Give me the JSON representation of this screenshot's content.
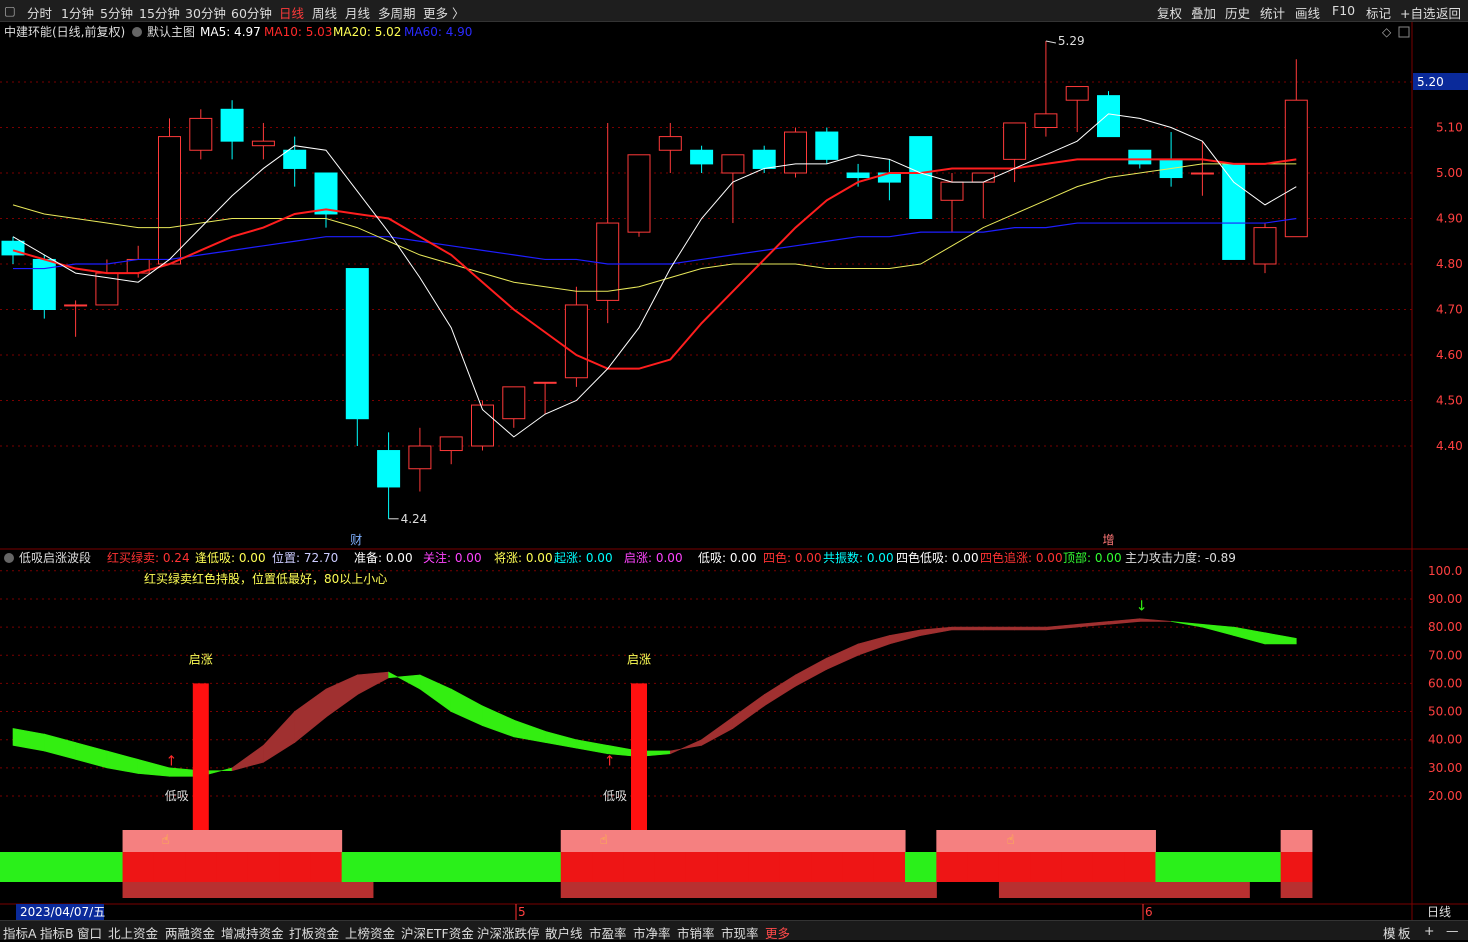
{
  "toolbar": {
    "periods": [
      "分时",
      "1分钟",
      "5分钟",
      "15分钟",
      "30分钟",
      "60分钟",
      "日线",
      "周线",
      "月线",
      "多周期",
      "更多 〉"
    ],
    "active_period": "日线",
    "right_items": [
      "复权",
      "叠加",
      "历史",
      "统计",
      "画线",
      "F10",
      "标记",
      "+自选",
      "返回"
    ]
  },
  "main_header": {
    "stock": "中建环能(日线,前复权)",
    "template": "默认主图",
    "ma": [
      {
        "label": "MA5: 4.97",
        "color": "#ffffff"
      },
      {
        "label": "MA10: 5.03",
        "color": "#ff2a2a"
      },
      {
        "label": "MA20: 5.02",
        "color": "#ffff55"
      },
      {
        "label": "MA60: 4.90",
        "color": "#2a2aff"
      }
    ]
  },
  "price_axis": {
    "ticks": [
      "5.20",
      "5.10",
      "5.00",
      "4.90",
      "4.80",
      "4.70",
      "4.60",
      "4.50",
      "4.40"
    ],
    "current_price": "5.20"
  },
  "annotations": {
    "high": "5.29",
    "low": "4.24",
    "marker1": "财",
    "marker2": "增"
  },
  "colors": {
    "up": "#ff3a3a",
    "down": "#00ffff",
    "ma5": "#ffffff",
    "ma10": "#ff1e1e",
    "ma20": "#e8e85a",
    "ma60": "#1e1eff",
    "grid": "#7a0000"
  },
  "chart_data": {
    "type": "candlestick",
    "candles": [
      {
        "o": 4.85,
        "h": 4.86,
        "l": 4.8,
        "c": 4.82
      },
      {
        "o": 4.81,
        "h": 4.82,
        "l": 4.68,
        "c": 4.7
      },
      {
        "o": 4.71,
        "h": 4.72,
        "l": 4.64,
        "c": 4.71
      },
      {
        "o": 4.71,
        "h": 4.81,
        "l": 4.71,
        "c": 4.78
      },
      {
        "o": 4.78,
        "h": 4.84,
        "l": 4.77,
        "c": 4.81
      },
      {
        "o": 4.8,
        "h": 5.12,
        "l": 4.8,
        "c": 5.08
      },
      {
        "o": 5.05,
        "h": 5.14,
        "l": 5.03,
        "c": 5.12
      },
      {
        "o": 5.14,
        "h": 5.16,
        "l": 5.03,
        "c": 5.07
      },
      {
        "o": 5.06,
        "h": 5.11,
        "l": 5.03,
        "c": 5.07
      },
      {
        "o": 5.05,
        "h": 5.08,
        "l": 4.97,
        "c": 5.01
      },
      {
        "o": 5.0,
        "h": 5.0,
        "l": 4.88,
        "c": 4.91
      },
      {
        "o": 4.79,
        "h": 4.79,
        "l": 4.4,
        "c": 4.46
      },
      {
        "o": 4.39,
        "h": 4.43,
        "l": 4.24,
        "c": 4.31
      },
      {
        "o": 4.35,
        "h": 4.44,
        "l": 4.3,
        "c": 4.4
      },
      {
        "o": 4.39,
        "h": 4.41,
        "l": 4.36,
        "c": 4.42
      },
      {
        "o": 4.4,
        "h": 4.5,
        "l": 4.39,
        "c": 4.49
      },
      {
        "o": 4.46,
        "h": 4.53,
        "l": 4.44,
        "c": 4.53
      },
      {
        "o": 4.54,
        "h": 4.54,
        "l": 4.47,
        "c": 4.54
      },
      {
        "o": 4.55,
        "h": 4.75,
        "l": 4.53,
        "c": 4.71
      },
      {
        "o": 4.72,
        "h": 5.11,
        "l": 4.67,
        "c": 4.89
      },
      {
        "o": 4.87,
        "h": 5.04,
        "l": 4.86,
        "c": 5.04
      },
      {
        "o": 5.05,
        "h": 5.11,
        "l": 5.0,
        "c": 5.08
      },
      {
        "o": 5.05,
        "h": 5.06,
        "l": 5.0,
        "c": 5.02
      },
      {
        "o": 5.0,
        "h": 5.04,
        "l": 4.89,
        "c": 5.04
      },
      {
        "o": 5.05,
        "h": 5.06,
        "l": 5.0,
        "c": 5.01
      },
      {
        "o": 5.0,
        "h": 5.1,
        "l": 4.99,
        "c": 5.09
      },
      {
        "o": 5.09,
        "h": 5.1,
        "l": 5.02,
        "c": 5.03
      },
      {
        "o": 5.0,
        "h": 5.02,
        "l": 4.97,
        "c": 4.99
      },
      {
        "o": 5.0,
        "h": 5.03,
        "l": 4.94,
        "c": 4.98
      },
      {
        "o": 5.08,
        "h": 5.08,
        "l": 4.9,
        "c": 4.9
      },
      {
        "o": 4.94,
        "h": 5.0,
        "l": 4.87,
        "c": 4.98
      },
      {
        "o": 4.98,
        "h": 5.0,
        "l": 4.9,
        "c": 5.0
      },
      {
        "o": 5.03,
        "h": 5.11,
        "l": 4.98,
        "c": 5.11
      },
      {
        "o": 5.1,
        "h": 5.29,
        "l": 5.08,
        "c": 5.13
      },
      {
        "o": 5.16,
        "h": 5.18,
        "l": 5.09,
        "c": 5.19
      },
      {
        "o": 5.17,
        "h": 5.18,
        "l": 5.08,
        "c": 5.08
      },
      {
        "o": 5.05,
        "h": 5.05,
        "l": 5.01,
        "c": 5.02
      },
      {
        "o": 5.03,
        "h": 5.09,
        "l": 4.97,
        "c": 4.99
      },
      {
        "o": 5.0,
        "h": 5.07,
        "l": 4.95,
        "c": 5.0
      },
      {
        "o": 5.02,
        "h": 5.02,
        "l": 4.81,
        "c": 4.81
      },
      {
        "o": 4.8,
        "h": 4.89,
        "l": 4.78,
        "c": 4.88
      },
      {
        "o": 4.86,
        "h": 5.25,
        "l": 4.86,
        "c": 5.16
      }
    ],
    "ma5": [
      4.86,
      4.82,
      4.78,
      4.77,
      4.76,
      4.81,
      4.88,
      4.95,
      5.01,
      5.06,
      5.05,
      4.96,
      4.87,
      4.77,
      4.66,
      4.48,
      4.42,
      4.47,
      4.5,
      4.57,
      4.66,
      4.79,
      4.9,
      4.98,
      5.01,
      5.02,
      5.02,
      5.04,
      5.03,
      5.0,
      4.98,
      4.98,
      5.01,
      5.04,
      5.07,
      5.13,
      5.12,
      5.1,
      5.07,
      4.98,
      4.93,
      4.97
    ],
    "ma10": [
      4.83,
      4.81,
      4.79,
      4.78,
      4.78,
      4.8,
      4.83,
      4.86,
      4.88,
      4.91,
      4.92,
      4.91,
      4.9,
      4.86,
      4.82,
      4.76,
      4.7,
      4.65,
      4.6,
      4.57,
      4.57,
      4.59,
      4.67,
      4.74,
      4.81,
      4.88,
      4.94,
      4.98,
      5.0,
      5.0,
      5.01,
      5.01,
      5.01,
      5.02,
      5.03,
      5.03,
      5.03,
      5.03,
      5.03,
      5.02,
      5.02,
      5.03
    ],
    "ma20": [
      4.93,
      4.91,
      4.9,
      4.89,
      4.88,
      4.88,
      4.89,
      4.9,
      4.9,
      4.9,
      4.9,
      4.88,
      4.85,
      4.82,
      4.8,
      4.78,
      4.76,
      4.75,
      4.74,
      4.74,
      4.75,
      4.77,
      4.79,
      4.8,
      4.8,
      4.8,
      4.79,
      4.79,
      4.79,
      4.8,
      4.84,
      4.88,
      4.91,
      4.94,
      4.97,
      4.99,
      5.0,
      5.01,
      5.02,
      5.02,
      5.02,
      5.02
    ],
    "ma60": [
      4.79,
      4.79,
      4.8,
      4.8,
      4.81,
      4.81,
      4.82,
      4.83,
      4.84,
      4.85,
      4.86,
      4.86,
      4.86,
      4.85,
      4.84,
      4.83,
      4.82,
      4.81,
      4.81,
      4.8,
      4.8,
      4.8,
      4.81,
      4.82,
      4.83,
      4.84,
      4.85,
      4.86,
      4.86,
      4.87,
      4.87,
      4.87,
      4.88,
      4.88,
      4.89,
      4.89,
      4.89,
      4.89,
      4.89,
      4.89,
      4.89,
      4.9
    ]
  },
  "indicator": {
    "name": "低吸启涨波段",
    "values": [
      {
        "label": "红买绿卖:",
        "value": "0.24",
        "color": "#ff3333"
      },
      {
        "label": "逢低吸:",
        "value": "0.00",
        "color": "#ffff55"
      },
      {
        "label": "位置:",
        "value": "72.70",
        "color": "#ccccff"
      },
      {
        "label": "准备:",
        "value": "0.00",
        "color": "#ffffff"
      },
      {
        "label": "关注:",
        "value": "0.00",
        "color": "#ff44ff"
      },
      {
        "label": "将涨:",
        "value": "0.00",
        "color": "#ffff55"
      },
      {
        "label": "起涨:",
        "value": "0.00",
        "color": "#00ffff"
      },
      {
        "label": "启涨:",
        "value": "0.00",
        "color": "#ff44ff"
      },
      {
        "label": "低吸:",
        "value": "0.00",
        "color": "#ffffff"
      },
      {
        "label": "四色:",
        "value": "0.00",
        "color": "#ff3333"
      },
      {
        "label": "共振数:",
        "value": "0.00",
        "color": "#00ffff"
      },
      {
        "label": "四色低吸:",
        "value": "0.00",
        "color": "#ffffff"
      },
      {
        "label": "四色追涨:",
        "value": "0.00",
        "color": "#ff3333"
      },
      {
        "label": "顶部:",
        "value": "0.00",
        "color": "#33ff33"
      },
      {
        "label": "主力攻击力度:",
        "value": "-0.89",
        "color": "#dddddd"
      }
    ],
    "note": "红买绿卖红色持股，位置低最好，80以上小心",
    "signal_labels": {
      "start": "启涨",
      "low": "低吸"
    },
    "axis_ticks": [
      "100.0",
      "90.00",
      "80.00",
      "70.00",
      "60.00",
      "50.00",
      "40.00",
      "30.00",
      "20.00"
    ],
    "band_a": [
      44,
      42,
      39,
      36,
      33,
      30,
      29,
      29,
      32,
      39,
      48,
      56,
      62,
      63,
      58,
      52,
      47,
      43,
      40,
      38,
      36,
      36,
      38,
      44,
      52,
      59,
      65,
      70,
      74,
      77,
      79,
      79,
      79,
      79,
      80,
      81,
      82,
      82,
      81,
      80,
      78,
      76
    ],
    "band_b": [
      38,
      36,
      33,
      30,
      28,
      27,
      27,
      30,
      38,
      50,
      58,
      63,
      64,
      58,
      50,
      45,
      41,
      39,
      37,
      35,
      34,
      35,
      40,
      48,
      56,
      63,
      69,
      74,
      77,
      79,
      80,
      80,
      80,
      80,
      81,
      82,
      83,
      82,
      80,
      77,
      74,
      74
    ],
    "bottom_row1": [
      "g",
      "g",
      "g",
      "g",
      "r",
      "r",
      "r",
      "r",
      "r",
      "r",
      "r",
      "g",
      "g",
      "g",
      "g",
      "g",
      "g",
      "g",
      "r",
      "r",
      "r",
      "r",
      "r",
      "r",
      "r",
      "r",
      "r",
      "r",
      "r",
      "g",
      "r",
      "r",
      "r",
      "r",
      "r",
      "r",
      "r",
      "g",
      "g",
      "g",
      "g",
      "r"
    ],
    "bottom_row2": [
      "n",
      "n",
      "n",
      "n",
      "r",
      "r",
      "r",
      "r",
      "r",
      "r",
      "r",
      "r",
      "n",
      "n",
      "n",
      "n",
      "n",
      "n",
      "r",
      "r",
      "r",
      "r",
      "r",
      "r",
      "r",
      "r",
      "r",
      "r",
      "r",
      "r",
      "n",
      "n",
      "r",
      "r",
      "r",
      "r",
      "r",
      "r",
      "r",
      "r",
      "n",
      "r"
    ]
  },
  "date_axis": {
    "current_date": "2023/04/07/五",
    "month_labels": [
      "5",
      "6"
    ]
  },
  "bottom_bar": {
    "tabs": [
      "指标A",
      "指标B",
      "窗口",
      "北上资金",
      "两融资金",
      "增减持资金",
      "打板资金",
      "上榜资金",
      "沪深ETF资金",
      "沪深涨跌停",
      "散户线",
      "市盈率",
      "市净率",
      "市销率",
      "市现率",
      "更多"
    ],
    "right": [
      "模",
      "板",
      "+",
      "—"
    ],
    "period_label": "日线"
  }
}
